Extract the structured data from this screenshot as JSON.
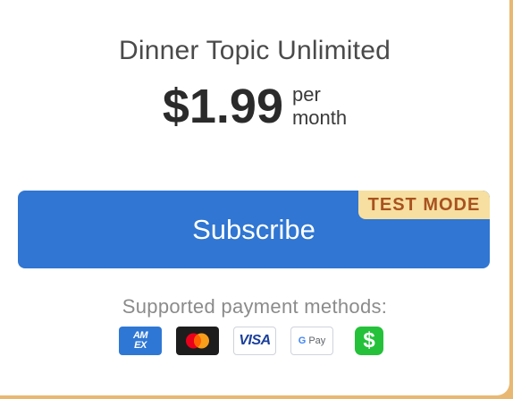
{
  "plan": {
    "title": "Dinner Topic Unlimited",
    "price": "$1.99",
    "period_line1": "per",
    "period_line2": "month"
  },
  "subscribe": {
    "label": "Subscribe",
    "badge": "TEST MODE"
  },
  "payment": {
    "heading": "Supported payment methods:",
    "methods": [
      {
        "name": "amex",
        "icon": "amex-icon",
        "text_line1": "AM",
        "text_line2": "EX"
      },
      {
        "name": "mastercard",
        "icon": "mastercard-icon"
      },
      {
        "name": "visa",
        "icon": "visa-icon",
        "text": "VISA"
      },
      {
        "name": "google-pay",
        "icon": "google-pay-icon",
        "text_g": "G",
        "text_pay": "Pay"
      },
      {
        "name": "cash-app",
        "icon": "cash-app-icon",
        "text": "$"
      }
    ]
  },
  "colors": {
    "accent": "#3076d2",
    "badge_bg": "#f6dfa0",
    "badge_text": "#a8521f",
    "frame": "#e8b872"
  }
}
